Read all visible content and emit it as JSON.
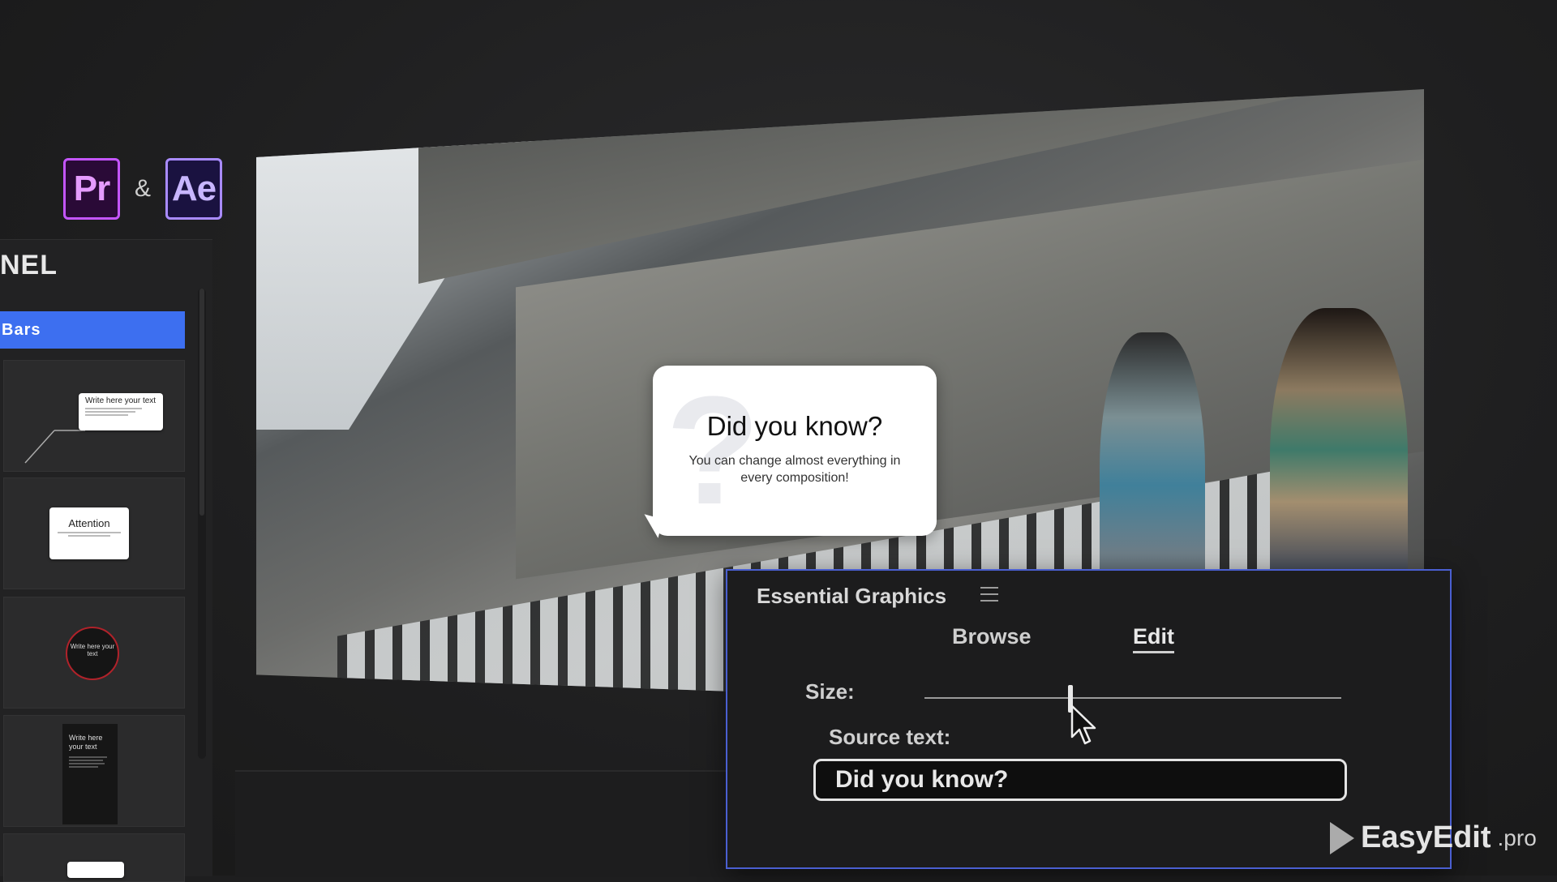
{
  "apps": {
    "premiere": "Pr",
    "ampersand": "&",
    "after_effects": "Ae"
  },
  "left_panel": {
    "title": "NEL",
    "category": "Bars",
    "thumbnails": [
      {
        "title": "Write here your text"
      },
      {
        "title": "Attention"
      },
      {
        "title": "Write here your text"
      },
      {
        "title": "Write here your text"
      }
    ]
  },
  "preview": {
    "callout": {
      "title": "Did you know?",
      "body": "You can change almost everything in every composition!",
      "glyph": "?"
    }
  },
  "essential_graphics": {
    "title": "Essential Graphics",
    "tabs": {
      "browse": "Browse",
      "edit": "Edit",
      "active": "Edit"
    },
    "size_label": "Size:",
    "size_value": 0.35,
    "source_label": "Source text:",
    "source_value": "Did you know?"
  },
  "watermark": {
    "main": "EasyEdit",
    "sub": ".pro"
  },
  "colors": {
    "accent_blue": "#3d6ff0",
    "panel_border": "#4a5fd1",
    "premiere": "#c455ff",
    "after_effects": "#a98bff"
  }
}
